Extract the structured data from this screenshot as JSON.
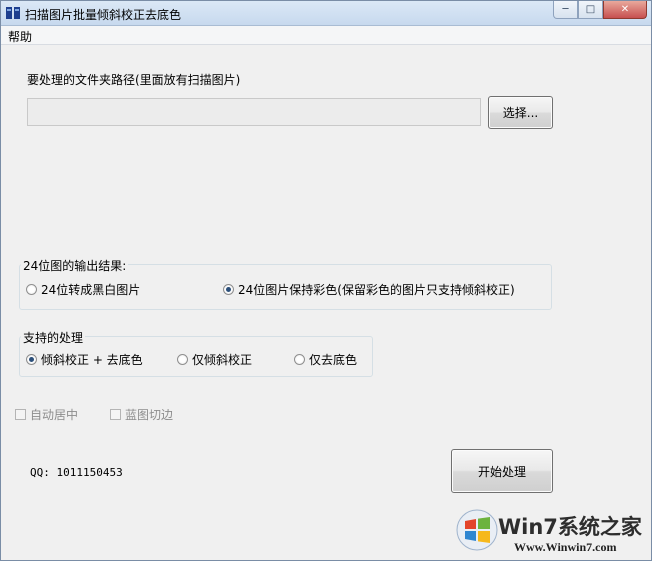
{
  "window": {
    "title": "扫描图片批量倾斜校正去底色",
    "controls": {
      "minimize": "─",
      "maximize": "□",
      "close": "✕"
    }
  },
  "menu": {
    "help": "帮助"
  },
  "folder": {
    "label": "要处理的文件夹路径(里面放有扫描图片)",
    "path_value": "",
    "browse_button": "选择..."
  },
  "output24": {
    "title": "24位图的输出结果:",
    "options": [
      {
        "label": "24位转成黑白图片",
        "checked": false
      },
      {
        "label": "24位图片保持彩色(保留彩色的图片只支持倾斜校正)",
        "checked": true
      }
    ]
  },
  "processing": {
    "title": "支持的处理",
    "options": [
      {
        "label": "倾斜校正 + 去底色",
        "checked": true
      },
      {
        "label": "仅倾斜校正",
        "checked": false
      },
      {
        "label": "仅去底色",
        "checked": false
      }
    ]
  },
  "checkboxes": [
    {
      "label": "自动居中",
      "checked": false,
      "enabled": false
    },
    {
      "label": "蓝图切边",
      "checked": false,
      "enabled": false
    }
  ],
  "contact": "QQ: 1011150453",
  "start_button": "开始处理",
  "watermark": {
    "main": "Win7系统之家",
    "url": "Www.Winwin7.com"
  },
  "colors": {
    "window_bg": "#f0f0f0",
    "titlebar": "#c7d9ee",
    "close_button": "#c75050"
  }
}
